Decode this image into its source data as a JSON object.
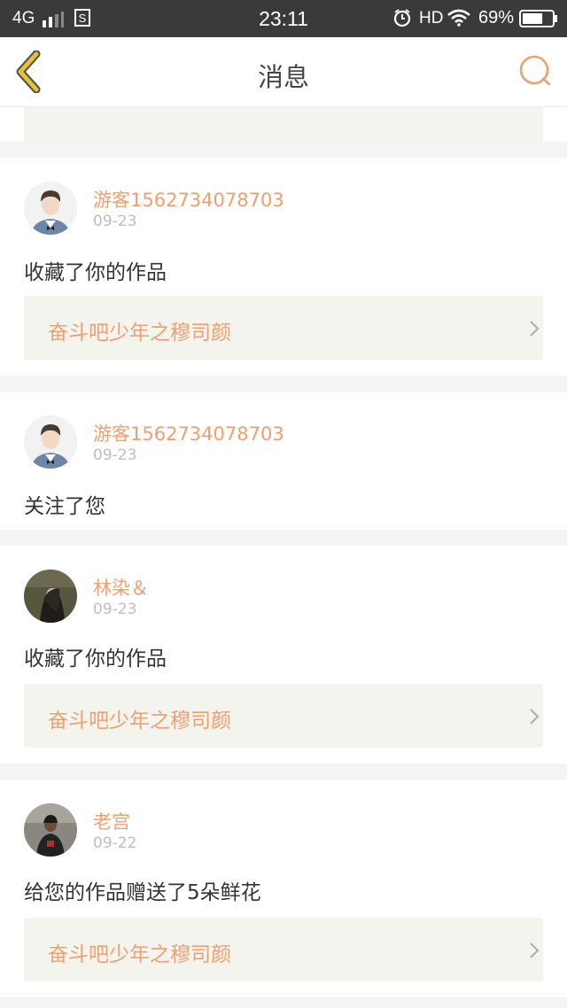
{
  "status_bar": {
    "network": "4G",
    "time": "23:11",
    "hd": "HD",
    "battery_pct": "69%",
    "battery_level": 0.69
  },
  "nav": {
    "title": "消息"
  },
  "colors": {
    "accent": "#f0a070",
    "back_icon": "#e5c233",
    "status_bar_bg": "#3a3a3a"
  },
  "notifications": [
    {
      "user": "游客1562734078703",
      "date": "09-23",
      "message": "收藏了你的作品",
      "work": "奋斗吧少年之穆司颜",
      "avatar_icon": "avatar-young-man-icon"
    },
    {
      "user": "游客1562734078703",
      "date": "09-23",
      "message": "关注了您",
      "avatar_icon": "avatar-young-man-icon"
    },
    {
      "user": "林染＆",
      "date": "09-23",
      "message": "收藏了你的作品",
      "work": "奋斗吧少年之穆司颜",
      "avatar_icon": "avatar-dark-photo-icon"
    },
    {
      "user": "老宫",
      "date": "09-22",
      "message": "给您的作品赠送了5朵鲜花",
      "work": "奋斗吧少年之穆司颜",
      "avatar_icon": "avatar-man-red-shirt-icon"
    }
  ]
}
